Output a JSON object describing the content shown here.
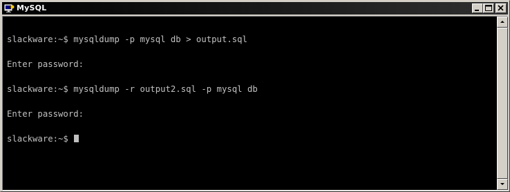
{
  "window": {
    "title": "MySQL",
    "icons": {
      "app": "mysql-app-icon",
      "minimize": "minimize-icon",
      "maximize": "maximize-icon",
      "close": "close-icon",
      "scroll_up": "arrow-up-icon",
      "scroll_down": "arrow-down-icon"
    }
  },
  "terminal": {
    "lines": [
      "slackware:~$ mysqldump -p mysql db > output.sql",
      "Enter password:",
      "slackware:~$ mysqldump -r output2.sql -p mysql db",
      "Enter password:",
      "slackware:~$ "
    ],
    "colors": {
      "background": "#000000",
      "foreground": "#c0c0c0"
    }
  },
  "theme": {
    "titlebar": "#000000",
    "chrome": "#d4d0c8"
  }
}
